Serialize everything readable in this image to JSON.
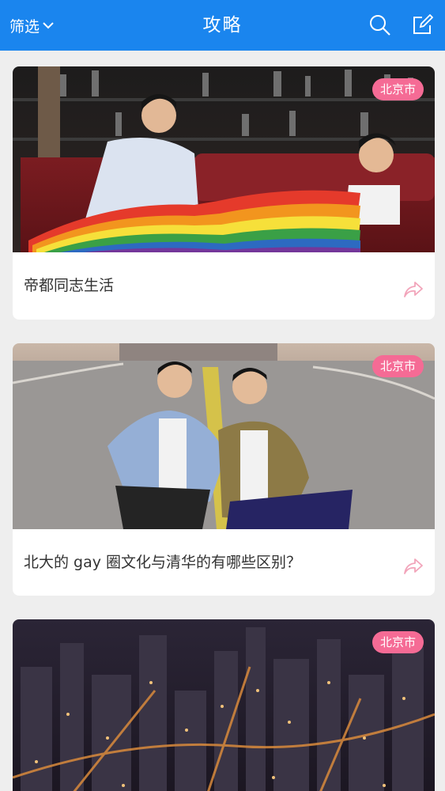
{
  "header": {
    "filter_label": "筛选",
    "title": "攻略",
    "icons": [
      "chevron-down-icon",
      "search-icon",
      "edit-icon"
    ]
  },
  "colors": {
    "header_bg": "#1a85ee",
    "badge_bg": "#f56b95",
    "share_icon": "#f2a4ba"
  },
  "cards": [
    {
      "city": "北京市",
      "caption": "帝都同志生活",
      "icon": "share-icon"
    },
    {
      "city": "北京市",
      "caption": "北大的 gay 圈文化与清华的有哪些区别？",
      "icon": "share-icon"
    },
    {
      "city": "北京市"
    }
  ]
}
